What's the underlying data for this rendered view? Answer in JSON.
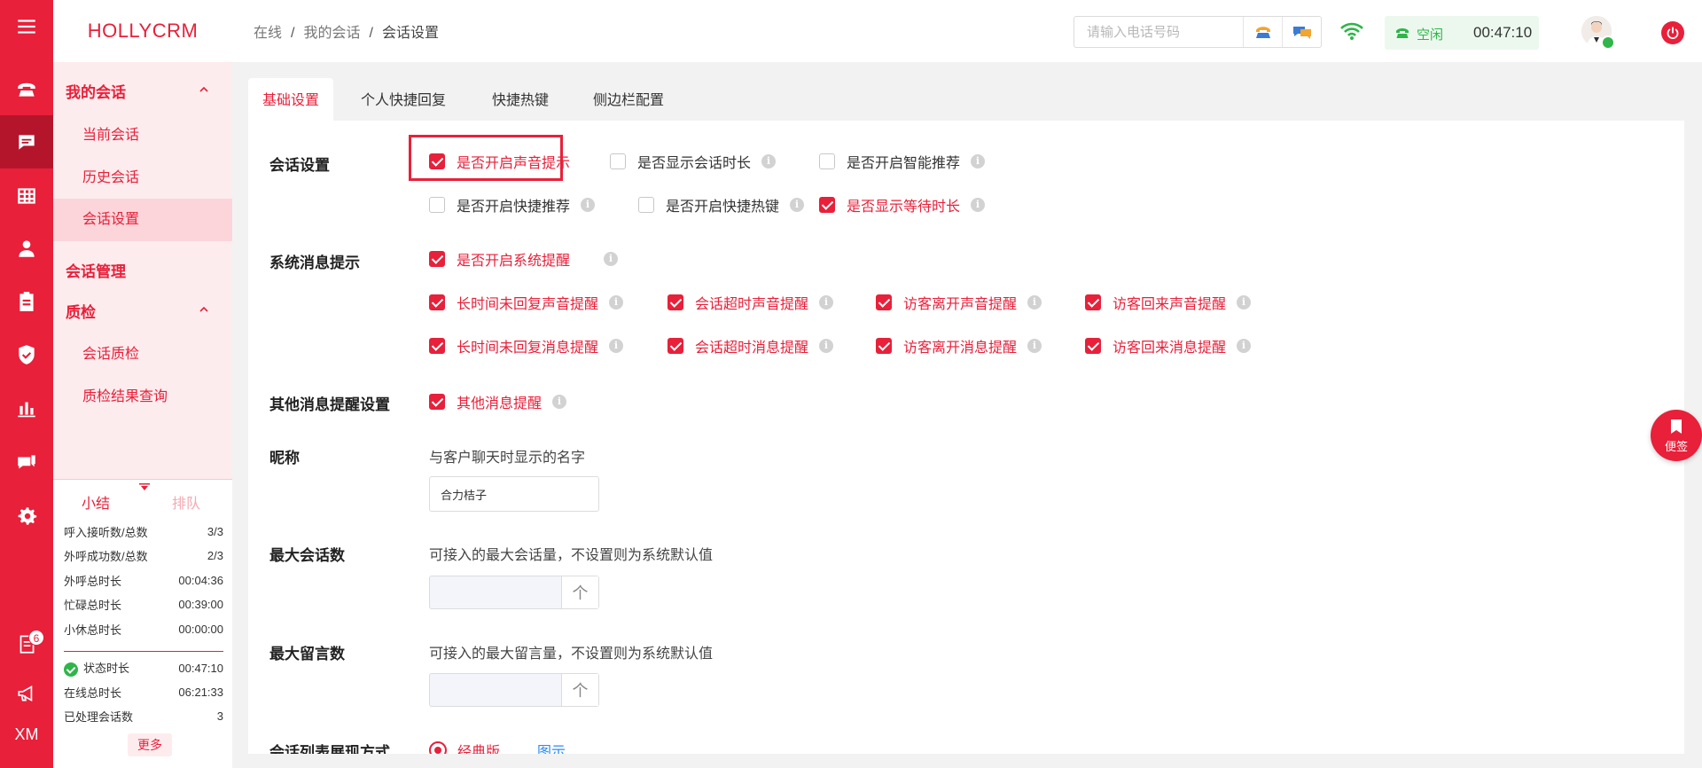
{
  "app": {
    "brand": "HOLLYCRM"
  },
  "rail": {
    "badge_count": "6",
    "user_initials": "XM"
  },
  "sidebar": {
    "group_my_session": "我的会话",
    "items_my_session": [
      "当前会话",
      "历史会话",
      "会话设置"
    ],
    "group_session_manage": "会话管理",
    "group_qc": "质检",
    "items_qc": [
      "会话质检",
      "质检结果查询"
    ]
  },
  "summary": {
    "tab_summary": "小结",
    "tab_queue": "排队",
    "rows": [
      {
        "label": "呼入接听数/总数",
        "value": "3/3"
      },
      {
        "label": "外呼成功数/总数",
        "value": "2/3"
      },
      {
        "label": "外呼总时长",
        "value": "00:04:36"
      },
      {
        "label": "忙碌总时长",
        "value": "00:39:00"
      },
      {
        "label": "小休总时长",
        "value": "00:00:00"
      }
    ],
    "rows2": [
      {
        "label": "状态时长",
        "value": "00:47:10"
      },
      {
        "label": "在线总时长",
        "value": "06:21:33"
      },
      {
        "label": "已处理会话数",
        "value": "3"
      }
    ],
    "more": "更多"
  },
  "header": {
    "breadcrumb": [
      "在线",
      "我的会话",
      "会话设置"
    ],
    "phone_placeholder": "请输入电话号码",
    "status_text": "空闲",
    "status_time": "00:47:10"
  },
  "tabs": [
    "基础设置",
    "个人快捷回复",
    "快捷热键",
    "侧边栏配置"
  ],
  "settings": {
    "session_settings": {
      "label": "会话设置",
      "options": [
        {
          "label": "是否开启声音提示",
          "checked": true
        },
        {
          "label": "是否显示会话时长",
          "checked": false
        },
        {
          "label": "是否开启智能推荐",
          "checked": false
        },
        {
          "label": "是否开启快捷推荐",
          "checked": false
        },
        {
          "label": "是否开启快捷热键",
          "checked": false
        },
        {
          "label": "是否显示等待时长",
          "checked": true
        }
      ]
    },
    "system_msg": {
      "label": "系统消息提示",
      "options": [
        {
          "label": "是否开启系统提醒",
          "checked": true
        },
        {
          "label": "长时间未回复声音提醒",
          "checked": true
        },
        {
          "label": "会话超时声音提醒",
          "checked": true
        },
        {
          "label": "访客离开声音提醒",
          "checked": true
        },
        {
          "label": "访客回来声音提醒",
          "checked": true
        },
        {
          "label": "长时间未回复消息提醒",
          "checked": true
        },
        {
          "label": "会话超时消息提醒",
          "checked": true
        },
        {
          "label": "访客离开消息提醒",
          "checked": true
        },
        {
          "label": "访客回来消息提醒",
          "checked": true
        }
      ]
    },
    "other_msg": {
      "label": "其他消息提醒设置",
      "options": [
        {
          "label": "其他消息提醒",
          "checked": true
        }
      ]
    },
    "nickname": {
      "label": "昵称",
      "desc": "与客户聊天时显示的名字",
      "value": "合力桔子"
    },
    "max_session": {
      "label": "最大会话数",
      "desc": "可接入的最大会话量，不设置则为系统默认值",
      "value": "",
      "step": "个"
    },
    "max_message": {
      "label": "最大留言数",
      "desc": "可接入的最大留言量，不设置则为系统默认值",
      "value": "",
      "step": "个"
    },
    "list_mode": {
      "label": "会话列表展现方式",
      "option_selected": "经典版",
      "link": "图示"
    }
  },
  "note_button": "便签",
  "colors": {
    "primary": "#e8203a",
    "success": "#2fb54a",
    "sidebar_bg": "#fdecee"
  }
}
